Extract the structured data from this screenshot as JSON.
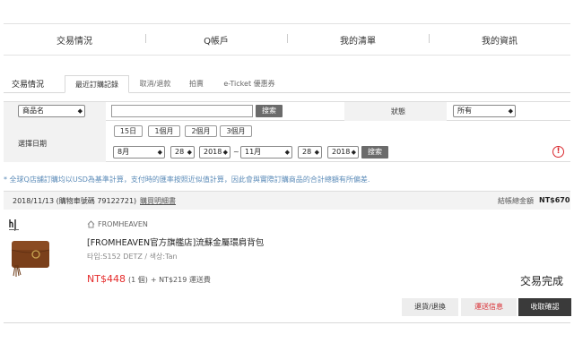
{
  "topnav": {
    "items": [
      "交易情況",
      "Q帳戶",
      "我的清單",
      "我的資訊"
    ]
  },
  "tabs": {
    "section_title": "交易情況",
    "items": [
      "最近訂購記錄",
      "取消/退款",
      "拍賣",
      "e-Ticket 優惠券"
    ]
  },
  "filter": {
    "search_type": "商品名",
    "search_button": "搜索",
    "state_label": "狀態",
    "state_value": "所有",
    "date_label": "選擇日期",
    "periods": [
      "15日",
      "1個月",
      "2個月",
      "3個月"
    ],
    "from_month": "8月",
    "from_day": "28",
    "from_year": "2018",
    "separator": "~",
    "to_month": "11月",
    "to_day": "28",
    "to_year": "2018",
    "date_search_button": "搜索",
    "alert_symbol": "!"
  },
  "notice": "* 全球Q店舖訂購均以USD為基準計算，支付時的匯率按照近似值計算，因此會與實際訂購商品的合計總額有所偏差.",
  "order": {
    "date": "2018/11/13",
    "cart_no": "(購物車號碼 79122721)",
    "receipt_link": "購買明細書",
    "total_label": "結帳總金額",
    "total_value": "NT$670",
    "shop_name": "FROMHEAVEN",
    "product_title": "[FROMHEAVEN官方旗艦店]流蘇金屬環肩背包",
    "product_option": "타입:S152 DETZ / 색상:Tan",
    "price": "NT$448",
    "qty": "(1 個)",
    "shipping": "+ NT$219 運送費",
    "status": "交易完成",
    "buttons": {
      "return": "退貨/退換",
      "tracking": "運送信息",
      "confirm": "收取確認"
    }
  },
  "colors": {
    "price_red": "#e52a2a",
    "notice_blue": "#5b8bb8",
    "dark_button": "#3a3a3a",
    "alert_red": "#d9262c"
  }
}
